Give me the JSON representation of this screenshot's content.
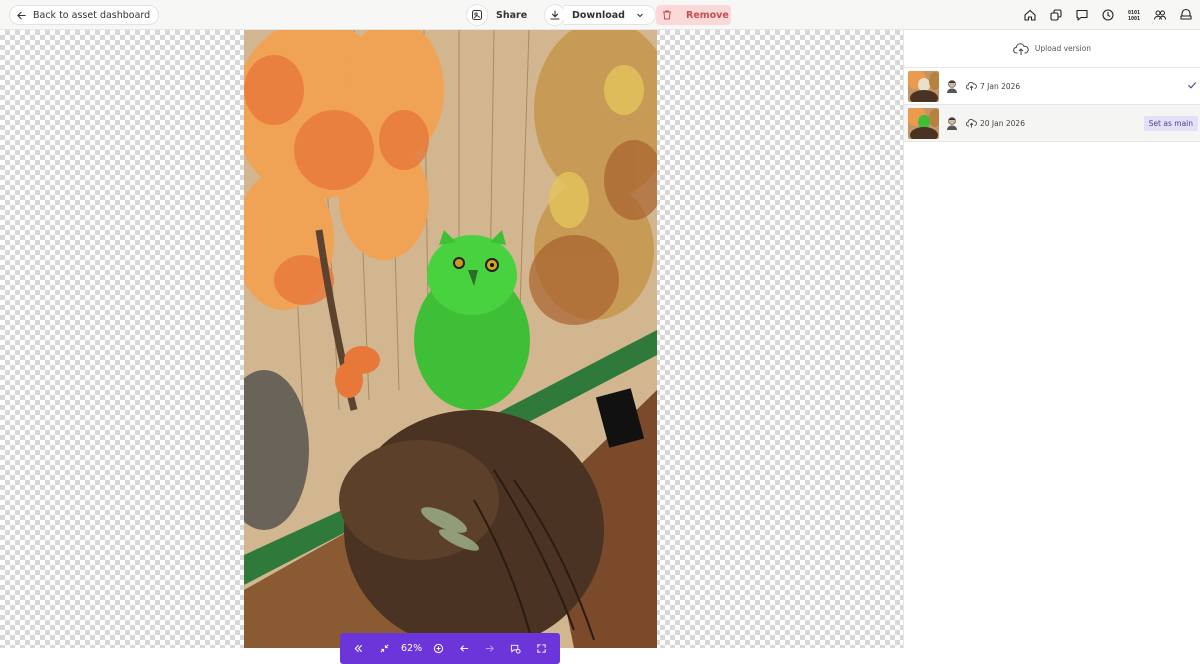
{
  "topbar": {
    "back_label": "Back to asset dashboard",
    "share_label": "Share",
    "download_label": "Download",
    "remove_label": "Remove",
    "right_icons": [
      "home-icon",
      "copy-icon",
      "comment-icon",
      "clock-icon",
      "binary-icon",
      "users-icon",
      "hat-icon"
    ]
  },
  "viewer": {
    "zoom": "62%",
    "tools": [
      "collapse-icon",
      "shrink-icon",
      "zoom-in-icon",
      "prev-arrow-icon",
      "next-arrow-icon",
      "tags-icon",
      "fullscreen-icon"
    ]
  },
  "side_panel": {
    "upload_label": "Upload version",
    "versions": [
      {
        "date": "7 Jan 2026",
        "is_main": true
      },
      {
        "date": "20 Jan 2026",
        "is_main": false,
        "action_label": "Set as main"
      }
    ]
  },
  "colors": {
    "accent": "#6c35d9",
    "remove_bg": "#fbd9d9",
    "remove_text": "#c0504d",
    "set_main_bg": "#e3e0f7"
  }
}
